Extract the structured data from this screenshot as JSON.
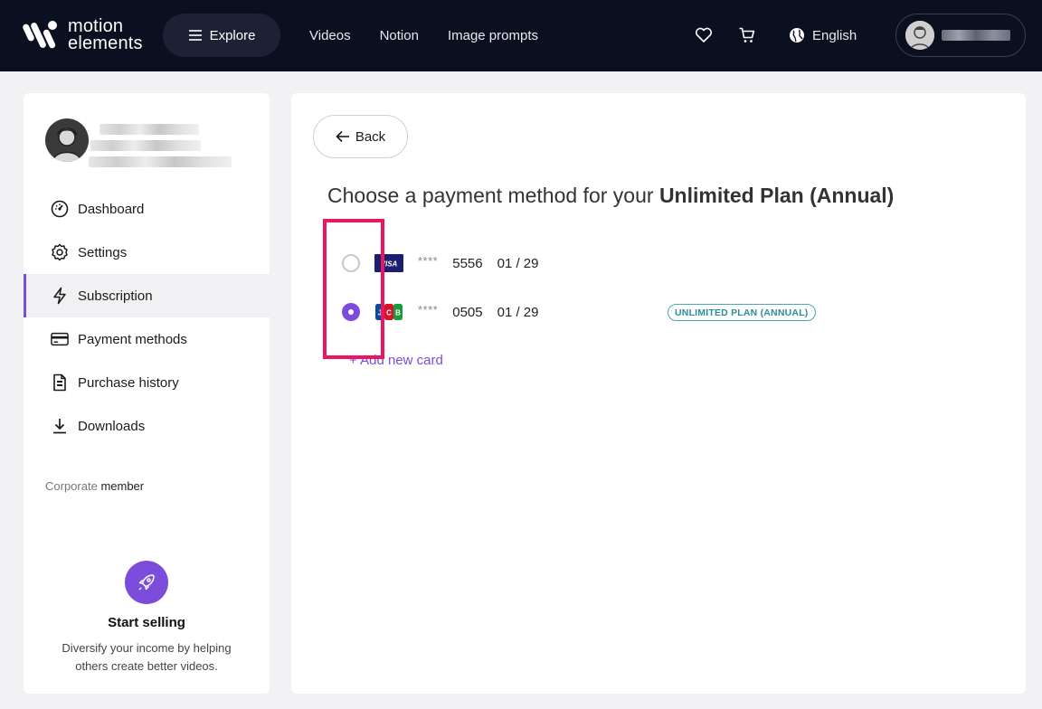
{
  "header": {
    "logo_line1": "motion",
    "logo_line2": "elements",
    "explore_label": "Explore",
    "nav": [
      "Videos",
      "Notion",
      "Image prompts"
    ],
    "language": "English",
    "icons": {
      "favorites": "heart-icon",
      "cart": "cart-icon",
      "language": "globe-icon",
      "menu": "hamburger-icon"
    }
  },
  "sidebar": {
    "menu": [
      {
        "label": "Dashboard",
        "icon": "dashboard-icon"
      },
      {
        "label": "Settings",
        "icon": "gear-icon"
      },
      {
        "label": "Subscription",
        "icon": "lightning-icon",
        "active": true
      },
      {
        "label": "Payment methods",
        "icon": "credit-card-icon"
      },
      {
        "label": "Purchase history",
        "icon": "receipt-icon"
      },
      {
        "label": "Downloads",
        "icon": "download-icon"
      }
    ],
    "member_prefix": "Corporate",
    "member_suffix": "member",
    "promo": {
      "title": "Start selling",
      "text": "Diversify your income by helping others create better videos."
    }
  },
  "main": {
    "back_label": "Back",
    "heading_prefix": "Choose a payment method for your",
    "heading_plan": "Unlimited Plan (Annual)",
    "cards": [
      {
        "brand": "VISA",
        "masked": "****",
        "last4": "5556",
        "expiry": "01 / 29",
        "selected": false
      },
      {
        "brand": "JCB",
        "masked": "****",
        "last4": "0505",
        "expiry": "01 / 29",
        "selected": true,
        "badge": "UNLIMITED PLAN (ANNUAL)"
      }
    ],
    "add_card_label": "+ Add new card"
  },
  "colors": {
    "accent": "#7c4ddb",
    "topbar": "#0b1020",
    "badge": "#2f8d98",
    "highlight": "#ee1560"
  }
}
